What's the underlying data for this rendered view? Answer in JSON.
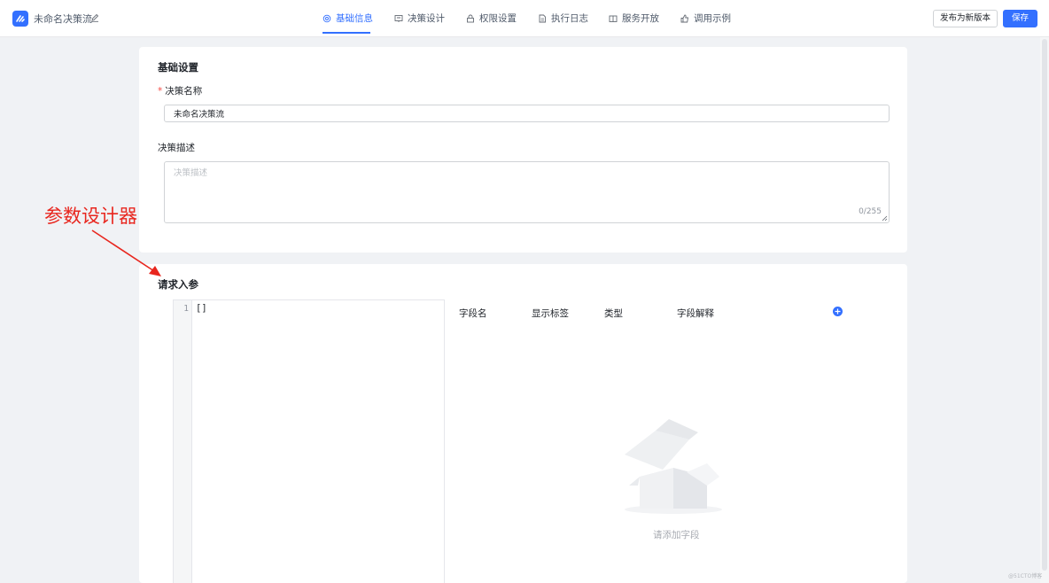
{
  "header": {
    "app_title": "未命名决策流",
    "tabs": [
      {
        "label": "基础信息",
        "icon": "settings-icon",
        "active": true
      },
      {
        "label": "决策设计",
        "icon": "design-icon",
        "active": false
      },
      {
        "label": "权限设置",
        "icon": "lock-icon",
        "active": false
      },
      {
        "label": "执行日志",
        "icon": "log-icon",
        "active": false
      },
      {
        "label": "服务开放",
        "icon": "book-icon",
        "active": false
      },
      {
        "label": "调用示例",
        "icon": "thumb-icon",
        "active": false
      }
    ],
    "publish_label": "发布为新版本",
    "save_label": "保存"
  },
  "basic_settings": {
    "title": "基础设置",
    "name_label": "决策名称",
    "name_value": "未命名决策流",
    "description_label": "决策描述",
    "description_placeholder": "决策描述",
    "char_count": "0/255"
  },
  "request_params": {
    "title": "请求入参",
    "editor": {
      "line_number": "1",
      "content": "[]"
    },
    "columns": [
      "字段名",
      "显示标签",
      "类型",
      "字段解释"
    ],
    "empty_text": "请添加字段"
  },
  "annotation": {
    "text": "参数设计器"
  },
  "watermark": "@51CTO博客",
  "colors": {
    "accent": "#3370ff",
    "annotation": "#e8261e",
    "required": "#f54a45"
  }
}
